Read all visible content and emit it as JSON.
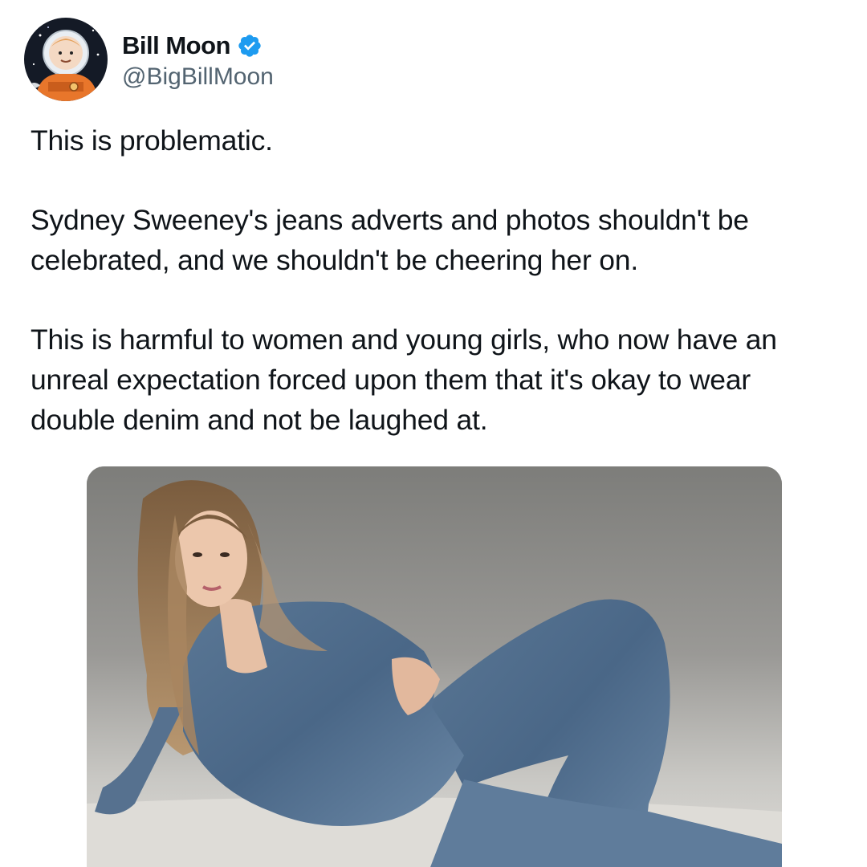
{
  "author": {
    "display_name": "Bill Moon",
    "handle": "@BigBillMoon",
    "verified": true,
    "verified_color": "#1d9bf0",
    "avatar_icon": "cartoon-astronaut-avatar"
  },
  "tweet": {
    "paragraphs": [
      "This is problematic.",
      "Sydney Sweeney's jeans adverts and photos shouldn't be celebrated, and we shouldn't be cheering her on.",
      "This is harmful to women and young girls, who now have an unreal expectation forced upon them that it's okay to wear double denim and not be laughed at."
    ]
  },
  "media": {
    "icon": "photo-woman-in-double-denim"
  },
  "colors": {
    "text": "#0f1419",
    "secondary_text": "#536471",
    "background": "#ffffff"
  }
}
